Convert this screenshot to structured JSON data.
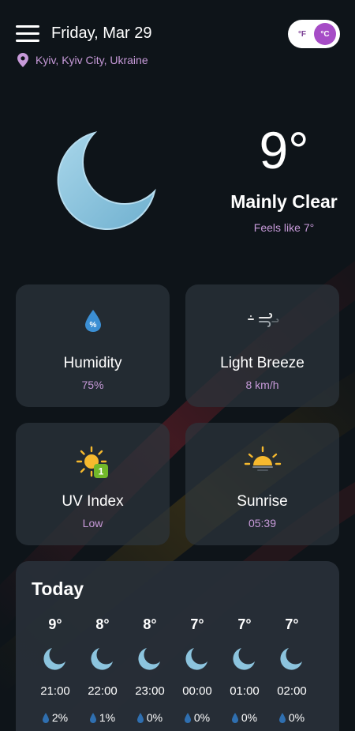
{
  "header": {
    "date": "Friday, Mar 29",
    "location": "Kyiv, Kyiv City, Ukraine",
    "unit_f": "°F",
    "unit_c": "°C",
    "active_unit": "°C"
  },
  "current": {
    "temperature": "9°",
    "condition": "Mainly Clear",
    "feels_like": "Feels like 7°",
    "icon": "crescent-moon-icon"
  },
  "cards": {
    "humidity": {
      "label": "Humidity",
      "value": "75%",
      "icon": "humidity-drop-icon"
    },
    "wind": {
      "label": "Light Breeze",
      "value": "8 km/h",
      "icon": "wind-icon"
    },
    "uv": {
      "label": "UV Index",
      "value": "Low",
      "icon": "uv-sun-icon",
      "badge": "1"
    },
    "sunrise": {
      "label": "Sunrise",
      "value": "05:39",
      "icon": "sunrise-icon"
    }
  },
  "today": {
    "title": "Today",
    "hours": [
      {
        "temp": "9°",
        "time": "21:00",
        "precip": "2%",
        "icon": "crescent-moon-icon"
      },
      {
        "temp": "8°",
        "time": "22:00",
        "precip": "1%",
        "icon": "crescent-moon-icon"
      },
      {
        "temp": "8°",
        "time": "23:00",
        "precip": "0%",
        "icon": "crescent-moon-icon"
      },
      {
        "temp": "7°",
        "time": "00:00",
        "precip": "0%",
        "icon": "crescent-moon-icon"
      },
      {
        "temp": "7°",
        "time": "01:00",
        "precip": "0%",
        "icon": "crescent-moon-icon"
      },
      {
        "temp": "7°",
        "time": "02:00",
        "precip": "0%",
        "icon": "crescent-moon-icon"
      }
    ]
  },
  "colors": {
    "background": "#0e1419",
    "accent": "#c79ad9",
    "toggle_active": "#a64cc6",
    "moon": "#8cc4de",
    "card": "#2c343c"
  }
}
